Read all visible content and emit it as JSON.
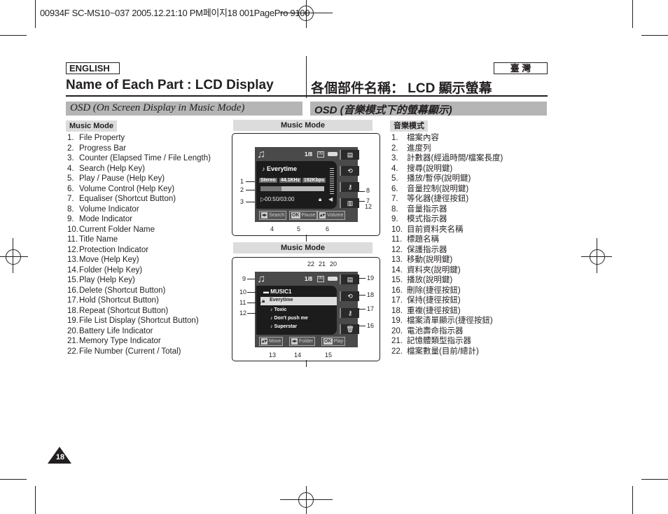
{
  "print_header": "00934F SC-MS10~037  2005.12.21:10 PM페이지18  001PagePro 9100",
  "lang_en": "ENGLISH",
  "lang_zh": "臺 灣",
  "title_en": "Name of Each Part : LCD Display",
  "title_zh": "各個部件名稱： LCD 顯示螢幕",
  "section_en": "OSD (On Screen Display in Music Mode)",
  "section_zh": "OSD (音樂模式下的螢幕顯示)",
  "sub_label_en": "Music Mode",
  "sub_label_zh": "音樂模式",
  "list_en": [
    {
      "n": "1.",
      "t": "File Property"
    },
    {
      "n": "2.",
      "t": "Progress Bar"
    },
    {
      "n": "3.",
      "t": "Counter (Elapsed Time / File Length)"
    },
    {
      "n": "4.",
      "t": "Search (Help Key)"
    },
    {
      "n": "5.",
      "t": "Play / Pause (Help Key)"
    },
    {
      "n": "6.",
      "t": "Volume Control (Help Key)"
    },
    {
      "n": "7.",
      "t": "Equaliser (Shortcut Button)"
    },
    {
      "n": "8.",
      "t": "Volume Indicator"
    },
    {
      "n": "9.",
      "t": "Mode Indicator"
    },
    {
      "n": "10.",
      "t": "Current Folder Name"
    },
    {
      "n": "11.",
      "t": "Title Name"
    },
    {
      "n": "12.",
      "t": "Protection Indicator"
    },
    {
      "n": "13.",
      "t": "Move (Help Key)"
    },
    {
      "n": "14.",
      "t": "Folder (Help Key)"
    },
    {
      "n": "15.",
      "t": "Play (Help Key)"
    },
    {
      "n": "16.",
      "t": "Delete (Shortcut Button)"
    },
    {
      "n": "17.",
      "t": "Hold (Shortcut Button)"
    },
    {
      "n": "18.",
      "t": "Repeat (Shortcut Button)"
    },
    {
      "n": "19.",
      "t": "File List Display (Shortcut Button)"
    },
    {
      "n": "20.",
      "t": "Battery Life Indicator"
    },
    {
      "n": "21.",
      "t": "Memory Type Indicator"
    },
    {
      "n": "22.",
      "t": "File Number (Current / Total)"
    }
  ],
  "list_zh": [
    {
      "n": "1.",
      "t": "檔案內容"
    },
    {
      "n": "2.",
      "t": "進度列"
    },
    {
      "n": "3.",
      "t": "計數器(經過時間/檔案長度)"
    },
    {
      "n": "4.",
      "t": "搜尋(說明鍵)"
    },
    {
      "n": "5.",
      "t": "播放/暫停(說明鍵)"
    },
    {
      "n": "6.",
      "t": "音量控制(說明鍵)"
    },
    {
      "n": "7.",
      "t": "等化器(捷徑按鈕)"
    },
    {
      "n": "8.",
      "t": "音量指示器"
    },
    {
      "n": "9.",
      "t": "模式指示器"
    },
    {
      "n": "10.",
      "t": "目前資料夾名稱"
    },
    {
      "n": "11.",
      "t": "標題名稱"
    },
    {
      "n": "12.",
      "t": "保護指示器"
    },
    {
      "n": "13.",
      "t": "移動(說明鍵)"
    },
    {
      "n": "14.",
      "t": "資料夾(說明鍵)"
    },
    {
      "n": "15.",
      "t": "播放(說明鍵)"
    },
    {
      "n": "16.",
      "t": "刪除(捷徑按鈕)"
    },
    {
      "n": "17.",
      "t": "保持(捷徑按鈕)"
    },
    {
      "n": "18.",
      "t": "重複(捷徑按鈕)"
    },
    {
      "n": "19.",
      "t": "檔案清單顯示(捷徑按鈕)"
    },
    {
      "n": "20.",
      "t": "電池壽命指示器"
    },
    {
      "n": "21.",
      "t": "記憶體類型指示器"
    },
    {
      "n": "22.",
      "t": "檔案數量(目前/總計)"
    }
  ],
  "screen1": {
    "header": "Music Mode",
    "file_number": "1/8",
    "memory": "IN",
    "title": "Everytime",
    "format": "Stereo",
    "sample_rate": "44.1KHz",
    "bitrate": "192Kbps",
    "counter": "00:50/03:00",
    "progress": 0.33,
    "help_keys": [
      {
        "key": "◂▸",
        "label": "Search"
      },
      {
        "key": "OK",
        "label": "Pause"
      },
      {
        "key": "▴▾",
        "label": "Volume"
      }
    ],
    "callouts": {
      "c1": "1",
      "c2": "2",
      "c3": "3",
      "c4": "4",
      "c5": "5",
      "c6": "6",
      "c7": "7",
      "c8": "8",
      "c12": "12"
    }
  },
  "screen2": {
    "header": "Music Mode",
    "file_number": "1/8",
    "memory": "IN",
    "folder": "MUSIC1",
    "tracks": [
      "Everytime",
      "Toxic",
      "Don't push me",
      "Superstar"
    ],
    "selected_track": "Everytime",
    "help_keys": [
      {
        "key": "▴▾",
        "label": "Move"
      },
      {
        "key": "◂▸",
        "label": "Folder"
      },
      {
        "key": "OK",
        "label": "Play"
      }
    ],
    "callouts": {
      "c9": "9",
      "c10": "10",
      "c11": "11",
      "c12": "12",
      "c13": "13",
      "c14": "14",
      "c15": "15",
      "c16": "16",
      "c17": "17",
      "c18": "18",
      "c19": "19",
      "c20": "20",
      "c21": "21",
      "c22": "22"
    }
  },
  "page_number": "18"
}
